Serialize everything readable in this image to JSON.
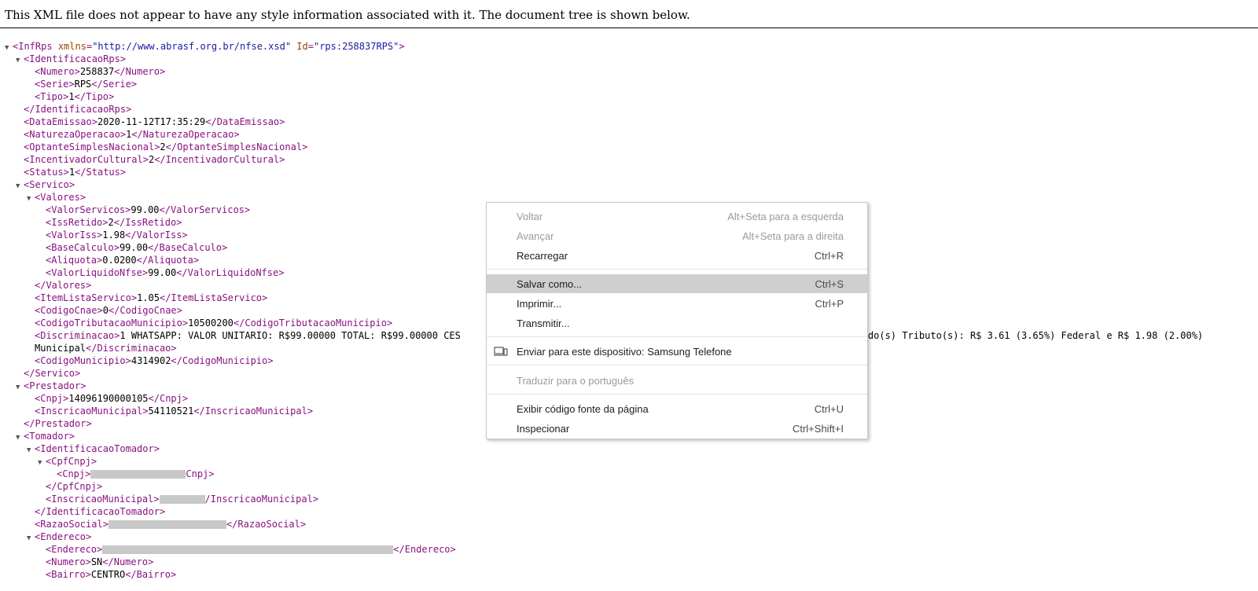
{
  "header": {
    "notice": "This XML file does not appear to have any style information associated with it. The document tree is shown below."
  },
  "tree": {
    "root_tag": "InfRps",
    "root_attr1_name": "xmlns",
    "root_attr1_value": "\"http://www.abrasf.org.br/nfse.xsd\"",
    "root_attr2_name": "Id",
    "root_attr2_value": "\"rps:258837RPS\"",
    "IdentificacaoRps": "IdentificacaoRps",
    "Numero": "Numero",
    "Numero_val": "258837",
    "Serie": "Serie",
    "Serie_val": "RPS",
    "Tipo": "Tipo",
    "Tipo_val": "1",
    "DataEmissao": "DataEmissao",
    "DataEmissao_val": "2020-11-12T17:35:29",
    "NaturezaOperacao": "NaturezaOperacao",
    "NaturezaOperacao_val": "1",
    "OptanteSimplesNacional": "OptanteSimplesNacional",
    "OptanteSimplesNacional_val": "2",
    "IncentivadorCultural": "IncentivadorCultural",
    "IncentivadorCultural_val": "2",
    "Status": "Status",
    "Status_val": "1",
    "Servico": "Servico",
    "Valores": "Valores",
    "ValorServicos": "ValorServicos",
    "ValorServicos_val": "99.00",
    "IssRetido": "IssRetido",
    "IssRetido_val": "2",
    "ValorIss": "ValorIss",
    "ValorIss_val": "1.98",
    "BaseCalculo": "BaseCalculo",
    "BaseCalculo_val": "99.00",
    "Aliquota": "Aliquota",
    "Aliquota_val": "0.0200",
    "ValorLiquidoNfse": "ValorLiquidoNfse",
    "ValorLiquidoNfse_val": "99.00",
    "ItemListaServico": "ItemListaServico",
    "ItemListaServico_val": "1.05",
    "CodigoCnae": "CodigoCnae",
    "CodigoCnae_val": "0",
    "CodigoTributacaoMunicipio": "CodigoTributacaoMunicipio",
    "CodigoTributacaoMunicipio_val": "10500200",
    "Discriminacao": "Discriminacao",
    "Discriminacao_val1": "1 WHATSAPP: VALOR UNITARIO: R$99.00000 TOTAL: R$99.00000 CES",
    "Discriminacao_val2": "ado do(s) Tributo(s): R$ 3.61 (3.65%) Federal e R$ 1.98 (2.00%)",
    "Discriminacao_val3": "Municipal",
    "CodigoMunicipio": "CodigoMunicipio",
    "CodigoMunicipio_val": "4314902",
    "Prestador": "Prestador",
    "Cnpj": "Cnpj",
    "Cnpj_val": "14096190000105",
    "InscricaoMunicipal": "InscricaoMunicipal",
    "InscricaoMunicipal_val": "54110521",
    "Tomador": "Tomador",
    "IdentificacaoTomador": "IdentificacaoTomador",
    "CpfCnpj": "CpfCnpj",
    "RazaoSocial": "RazaoSocial",
    "Endereco": "Endereco",
    "NumeroEnd_val": "SN",
    "Bairro": "Bairro",
    "Bairro_val": "CENTRO"
  },
  "context_menu": {
    "items": [
      {
        "label": "Voltar",
        "shortcut": "Alt+Seta para a esquerda"
      },
      {
        "label": "Avançar",
        "shortcut": "Alt+Seta para a direita"
      },
      {
        "label": "Recarregar",
        "shortcut": "Ctrl+R"
      },
      {
        "label": "Salvar como...",
        "shortcut": "Ctrl+S"
      },
      {
        "label": "Imprimir...",
        "shortcut": "Ctrl+P"
      },
      {
        "label": "Transmitir...",
        "shortcut": ""
      },
      {
        "label": "Enviar para este dispositivo: Samsung Telefone",
        "shortcut": "",
        "icon": "device-icon"
      },
      {
        "label": "Traduzir para o português",
        "shortcut": ""
      },
      {
        "label": "Exibir código fonte da página",
        "shortcut": "Ctrl+U"
      },
      {
        "label": "Inspecionar",
        "shortcut": "Ctrl+Shift+I"
      }
    ]
  },
  "colors": {
    "tag": "#881280",
    "attr_name": "#994500",
    "attr_value": "#1a1aa6",
    "menu_highlight": "#cfcfcf",
    "disabled_text": "#9a9a9a"
  }
}
